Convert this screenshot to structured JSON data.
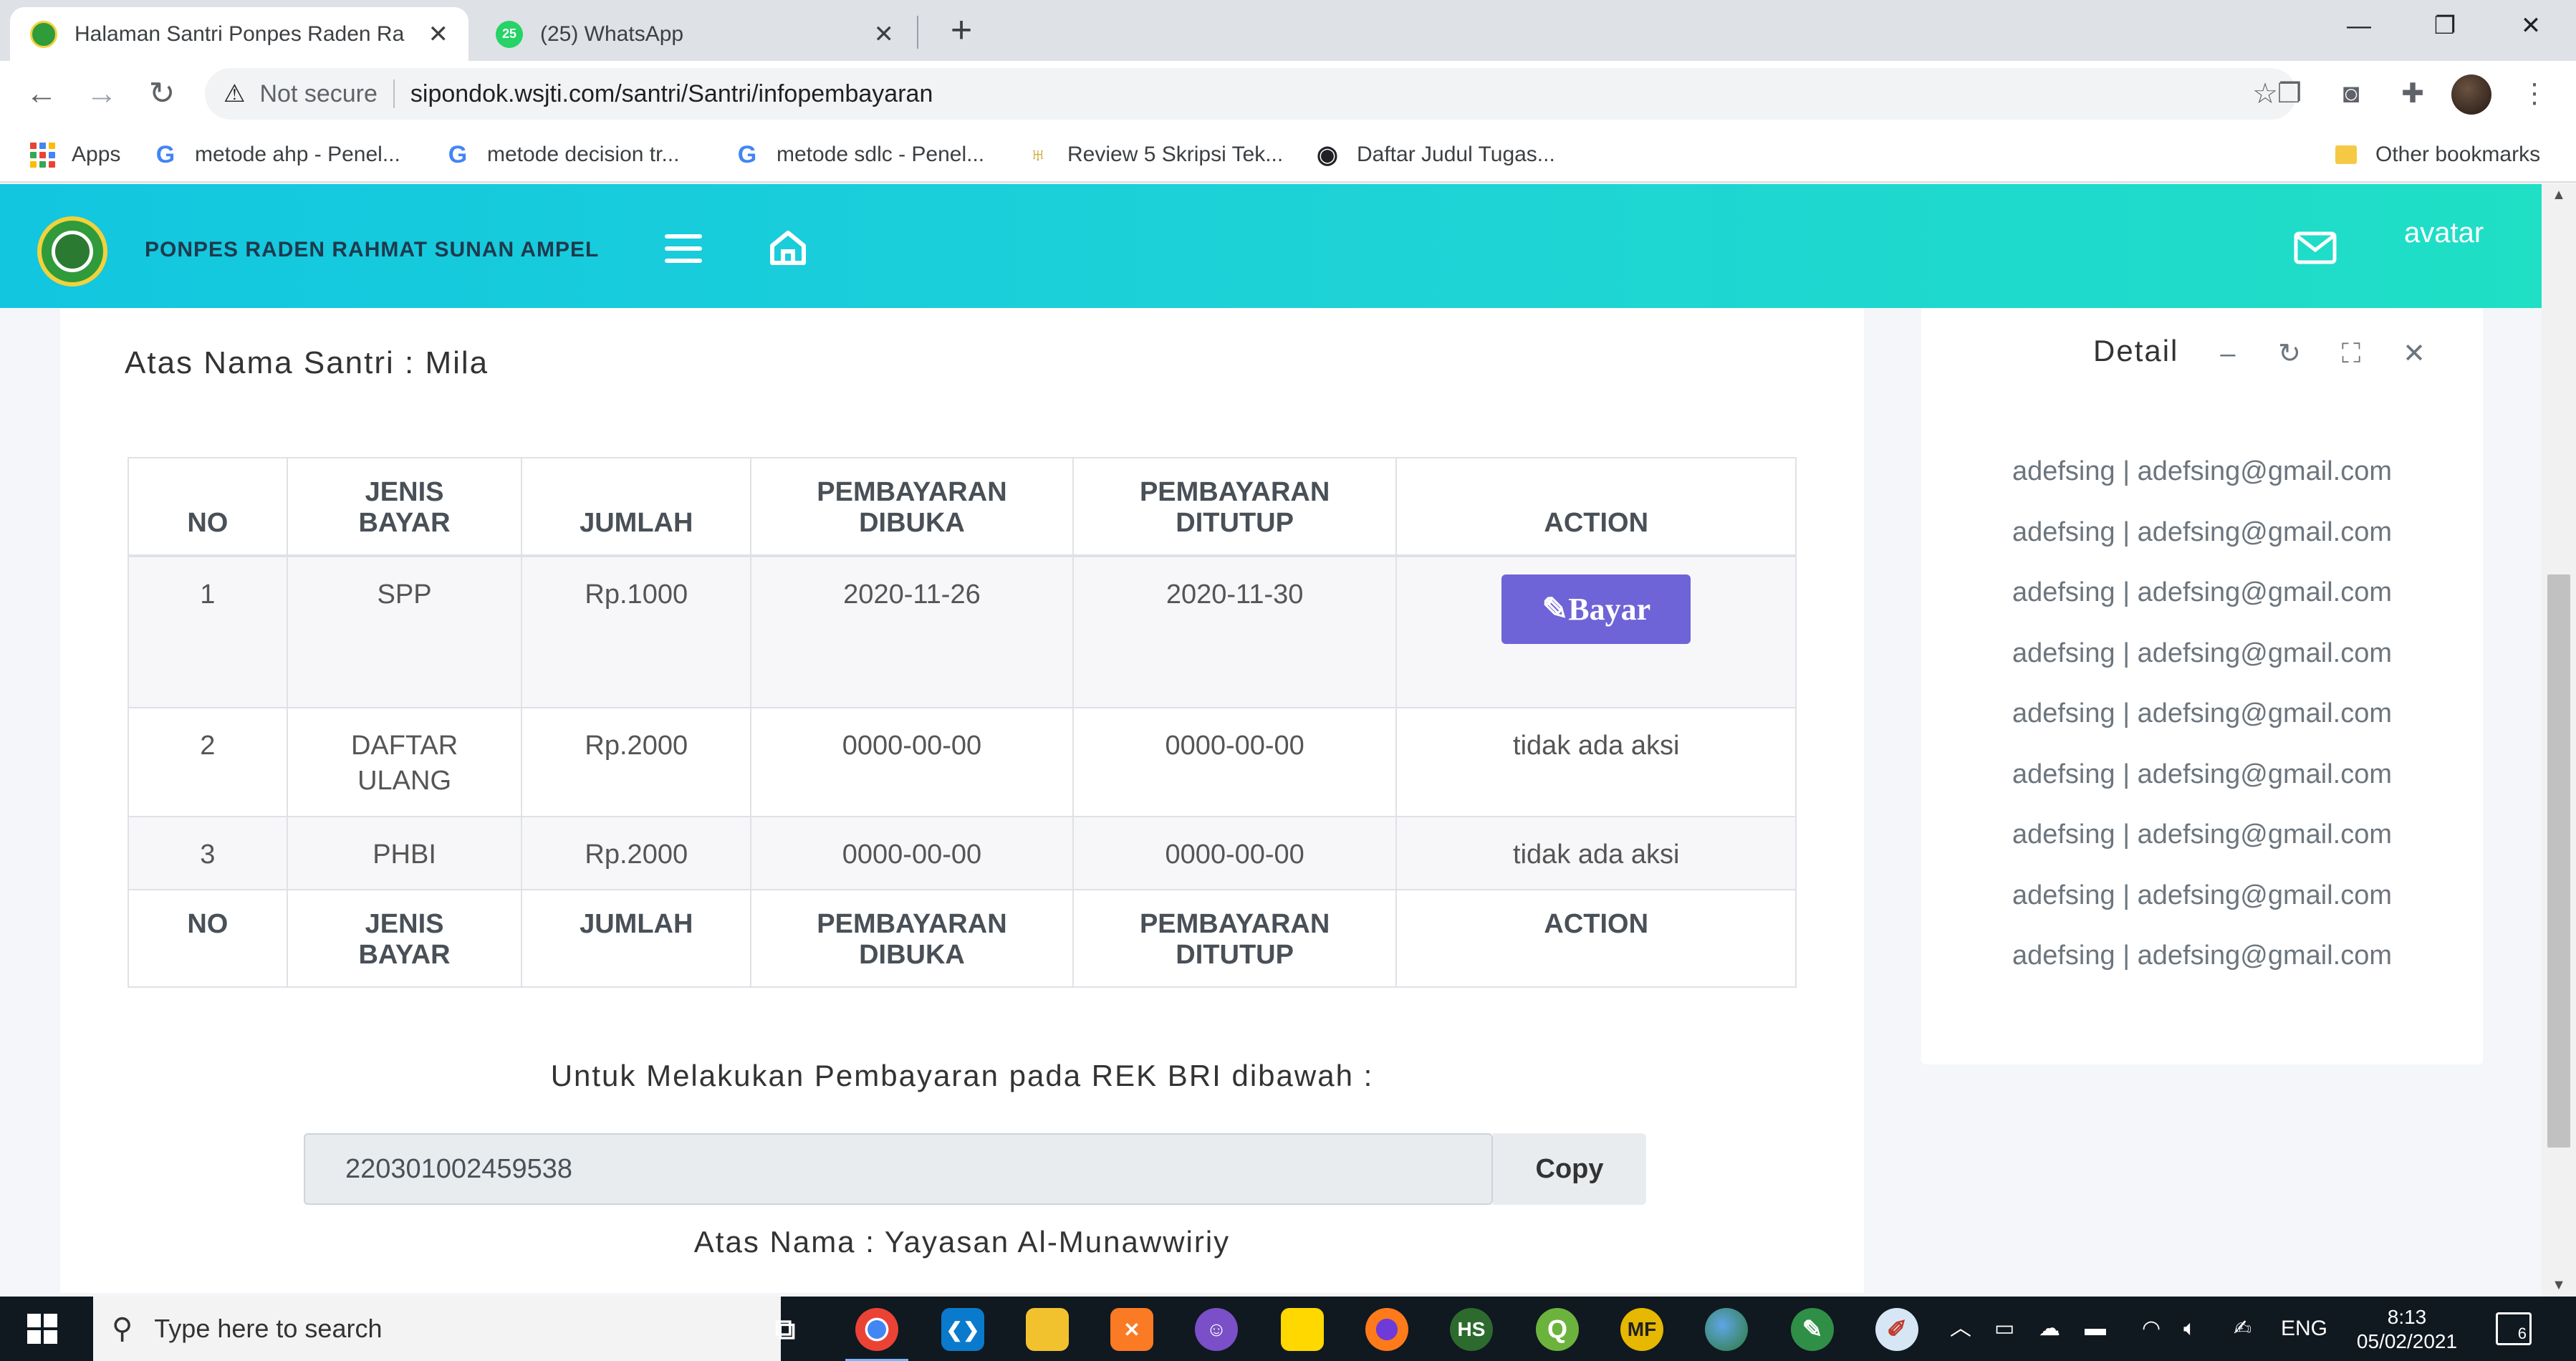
{
  "browser": {
    "tabs": [
      {
        "title": "Halaman Santri Ponpes Raden Ra",
        "active": true
      },
      {
        "title": "(25) WhatsApp",
        "badge": "25",
        "active": false
      }
    ],
    "new_tab": "+",
    "window_controls": {
      "minimize": "—",
      "restore": "❐",
      "close": "✕"
    },
    "address": {
      "security": "Not secure",
      "url": "sipondok.wsjti.com/santri/Santri/infopembayaran"
    },
    "bookmarks": [
      {
        "label": "Apps",
        "icon": "apps-grid-icon"
      },
      {
        "label": "metode ahp - Penel...",
        "icon": "google-icon"
      },
      {
        "label": "metode decision tr...",
        "icon": "google-icon"
      },
      {
        "label": "metode sdlc - Penel...",
        "icon": "google-icon"
      },
      {
        "label": "Review 5 Skripsi Tek...",
        "icon": "trophy-icon"
      },
      {
        "label": "Daftar Judul Tugas...",
        "icon": "globe-icon"
      }
    ],
    "other_bookmarks": "Other bookmarks"
  },
  "header": {
    "brand": "PONPES RADEN RAHMAT SUNAN AMPEL",
    "avatar_alt": "avatar",
    "colors": {
      "gradient_start": "#12c6e0",
      "gradient_end": "#1fdfc5",
      "brand_text": "#1f3a4d"
    }
  },
  "main": {
    "santri_label": "Atas Nama Santri : Mila",
    "table": {
      "headers": [
        {
          "l1": "",
          "l2": "NO"
        },
        {
          "l1": "JENIS",
          "l2": "BAYAR"
        },
        {
          "l1": "",
          "l2": "JUMLAH"
        },
        {
          "l1": "PEMBAYARAN",
          "l2": "DIBUKA"
        },
        {
          "l1": "PEMBAYARAN",
          "l2": "DITUTUP"
        },
        {
          "l1": "",
          "l2": "ACTION"
        }
      ],
      "footer": [
        {
          "l1": "NO",
          "l2": ""
        },
        {
          "l1": "JENIS",
          "l2": "BAYAR"
        },
        {
          "l1": "JUMLAH",
          "l2": ""
        },
        {
          "l1": "PEMBAYARAN",
          "l2": "DIBUKA"
        },
        {
          "l1": "PEMBAYARAN",
          "l2": "DITUTUP"
        },
        {
          "l1": "ACTION",
          "l2": ""
        }
      ],
      "rows": [
        {
          "no": "1",
          "jenis_l1": "SPP",
          "jenis_l2": "",
          "jumlah": "Rp.1000",
          "dibuka": "2020-11-26",
          "ditutup": "2020-11-30",
          "action": "Bayar",
          "action_type": "button"
        },
        {
          "no": "2",
          "jenis_l1": "DAFTAR",
          "jenis_l2": "ULANG",
          "jumlah": "Rp.2000",
          "dibuka": "0000-00-00",
          "ditutup": "0000-00-00",
          "action": "tidak ada aksi",
          "action_type": "text"
        },
        {
          "no": "3",
          "jenis_l1": "PHBI",
          "jenis_l2": "",
          "jumlah": "Rp.2000",
          "dibuka": "0000-00-00",
          "ditutup": "0000-00-00",
          "action": "tidak ada aksi",
          "action_type": "text"
        }
      ]
    },
    "rekening_label": "Untuk Melakukan Pembayaran pada REK BRI dibawah :",
    "rekening_number": "220301002459538",
    "copy_label": "Copy",
    "atas_nama": "Atas Nama : Yayasan Al-Munawwiriy",
    "colors": {
      "bayar_button": "#6f63d8"
    }
  },
  "detail": {
    "title": "Detail",
    "tools": {
      "minimize": "–",
      "refresh": "↻",
      "expand": "⛶",
      "close": "✕"
    },
    "items": [
      "adefsing | adefsing@gmail.com",
      "adefsing | adefsing@gmail.com",
      "adefsing | adefsing@gmail.com",
      "adefsing | adefsing@gmail.com",
      "adefsing | adefsing@gmail.com",
      "adefsing | adefsing@gmail.com",
      "adefsing | adefsing@gmail.com",
      "adefsing | adefsing@gmail.com",
      "adefsing | adefsing@gmail.com"
    ]
  },
  "taskbar": {
    "search_placeholder": "Type here to search",
    "apps": [
      {
        "name": "task-view",
        "icon": "task-view-icon"
      },
      {
        "name": "chrome",
        "icon": "chrome-icon"
      },
      {
        "name": "vscode",
        "icon": "vscode-icon"
      },
      {
        "name": "file-explorer",
        "icon": "folder-icon"
      },
      {
        "name": "xampp",
        "icon": "xampp-icon"
      },
      {
        "name": "app-purple",
        "icon": "cat-icon"
      },
      {
        "name": "sticky-notes",
        "icon": "note-icon"
      },
      {
        "name": "firefox",
        "icon": "firefox-icon"
      },
      {
        "name": "hs",
        "label": "HS",
        "icon": "hs-icon"
      },
      {
        "name": "qgis",
        "label": "Q",
        "icon": "qgis-icon"
      },
      {
        "name": "mf",
        "label": "MF",
        "icon": "mf-icon"
      },
      {
        "name": "earth",
        "icon": "earth-icon"
      },
      {
        "name": "pen-tool",
        "icon": "pen-icon"
      },
      {
        "name": "paint",
        "icon": "paint-icon"
      }
    ],
    "language": "ENG",
    "time": "8:13",
    "date": "05/02/2021",
    "notifications": "6"
  }
}
